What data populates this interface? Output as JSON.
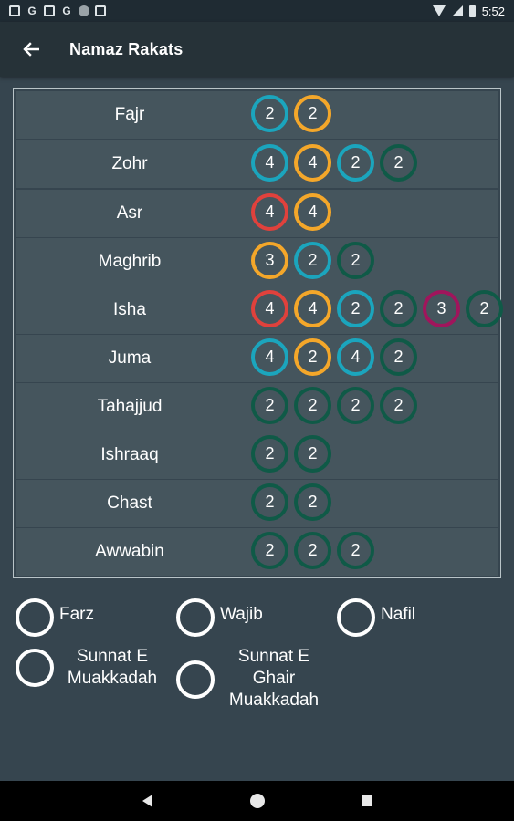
{
  "status_bar": {
    "time": "5:52",
    "left_icons": [
      "notification-icon",
      "google-icon",
      "gallery-icon",
      "google-icon",
      "dot-icon",
      "clipboard-icon"
    ],
    "right_icons": [
      "wifi-icon",
      "signal-icon",
      "battery-icon"
    ],
    "google_glyph": "G"
  },
  "app_bar": {
    "title": "Namaz Rakats",
    "back_icon": "arrow-back-icon"
  },
  "colors": {
    "background": "#36454f",
    "row": "#45555d",
    "farz": "#f4a72a",
    "sunnat_e_muakkadah": "#1ba5bd",
    "sunnat_e_ghair_muakkadah": "#e0413c",
    "wajib": "#a0155c",
    "nafil": "#0f5a47"
  },
  "rakats": [
    {
      "name": "Fajr",
      "units": [
        {
          "type": "sunnat",
          "count": "2"
        },
        {
          "type": "farz",
          "count": "2"
        }
      ]
    },
    {
      "name": "Zohr",
      "units": [
        {
          "type": "sunnat",
          "count": "4"
        },
        {
          "type": "farz",
          "count": "4"
        },
        {
          "type": "sunnat",
          "count": "2"
        },
        {
          "type": "nafil",
          "count": "2"
        }
      ]
    },
    {
      "name": "Asr",
      "units": [
        {
          "type": "ghair",
          "count": "4"
        },
        {
          "type": "farz",
          "count": "4"
        }
      ]
    },
    {
      "name": "Maghrib",
      "units": [
        {
          "type": "farz",
          "count": "3"
        },
        {
          "type": "sunnat",
          "count": "2"
        },
        {
          "type": "nafil",
          "count": "2"
        }
      ]
    },
    {
      "name": "Isha",
      "units": [
        {
          "type": "ghair",
          "count": "4"
        },
        {
          "type": "farz",
          "count": "4"
        },
        {
          "type": "sunnat",
          "count": "2"
        },
        {
          "type": "nafil",
          "count": "2"
        },
        {
          "type": "wajib",
          "count": "3"
        },
        {
          "type": "nafil",
          "count": "2"
        }
      ]
    },
    {
      "name": "Juma",
      "units": [
        {
          "type": "sunnat",
          "count": "4"
        },
        {
          "type": "farz",
          "count": "2"
        },
        {
          "type": "sunnat",
          "count": "4"
        },
        {
          "type": "nafil",
          "count": "2"
        }
      ]
    },
    {
      "name": "Tahajjud",
      "units": [
        {
          "type": "nafil",
          "count": "2"
        },
        {
          "type": "nafil",
          "count": "2"
        },
        {
          "type": "nafil",
          "count": "2"
        },
        {
          "type": "nafil",
          "count": "2"
        }
      ]
    },
    {
      "name": "Ishraaq",
      "units": [
        {
          "type": "nafil",
          "count": "2"
        },
        {
          "type": "nafil",
          "count": "2"
        }
      ]
    },
    {
      "name": "Chast",
      "units": [
        {
          "type": "nafil",
          "count": "2"
        },
        {
          "type": "nafil",
          "count": "2"
        }
      ]
    },
    {
      "name": "Awwabin",
      "units": [
        {
          "type": "nafil",
          "count": "2"
        },
        {
          "type": "nafil",
          "count": "2"
        },
        {
          "type": "nafil",
          "count": "2"
        }
      ]
    }
  ],
  "legend": {
    "farz": "Farz",
    "wajib": "Wajib",
    "nafil": "Nafil",
    "sunnat_e_muakkadah": "Sunnat E\nMuakkadah",
    "sunnat_e_ghair_muakkadah": "Sunnat E\nGhair\nMuakkadah"
  },
  "nav_bar": {
    "icons": [
      "nav-back-icon",
      "nav-home-icon",
      "nav-recents-icon"
    ]
  }
}
